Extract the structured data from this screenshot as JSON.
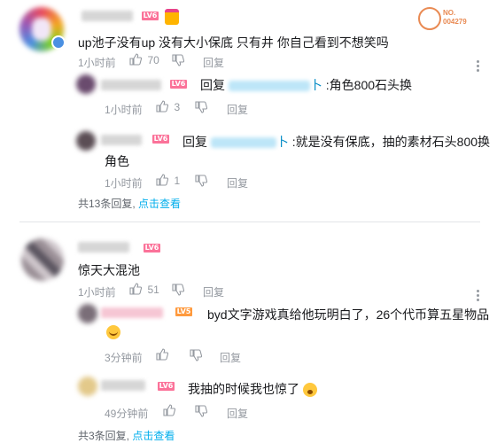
{
  "watermark": {
    "line1": "NO.",
    "line2": "004279"
  },
  "comments": [
    {
      "id": "c1",
      "level": "LV6",
      "text": "up池子没有up 没有大小保底  只有井 你自己看到不想笑吗",
      "time": "1小时前",
      "likes": "70",
      "reply_label": "回复",
      "replies": [
        {
          "level": "LV6",
          "reply_prefix": "回复",
          "at_suffix": "卜",
          "text": ":角色800石头换",
          "time": "1小时前",
          "likes": "3",
          "reply_label": "回复"
        },
        {
          "level": "LV6",
          "reply_prefix": "回复",
          "at_suffix": "卜",
          "text": ":就是没有保底，抽的素材石头800换",
          "text_line2": "角色",
          "time": "1小时前",
          "likes": "1",
          "reply_label": "回复"
        }
      ],
      "more": {
        "prefix": "共13条回复, ",
        "link": "点击查看"
      }
    },
    {
      "id": "c2",
      "level": "LV6",
      "text": "惊天大混池",
      "time": "1小时前",
      "likes": "51",
      "reply_label": "回复",
      "replies": [
        {
          "level": "LV5",
          "text": "byd文字游戏真给他玩明白了，26个代币算五星物品",
          "time": "3分钟前",
          "likes": "",
          "reply_label": "回复"
        },
        {
          "level": "LV6",
          "text": "我抽的时候我也惊了",
          "time": "49分钟前",
          "likes": "",
          "reply_label": "回复"
        }
      ],
      "more": {
        "prefix": "共3条回复, ",
        "link": "点击查看"
      }
    }
  ]
}
